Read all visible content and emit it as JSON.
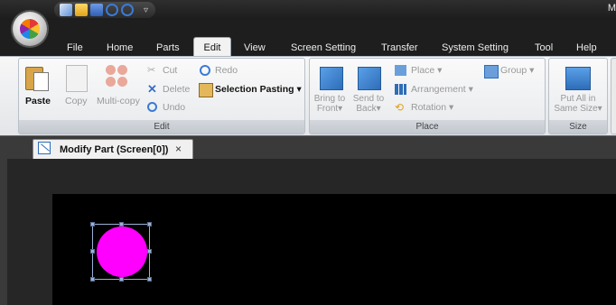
{
  "window": {
    "title_fragment": "M"
  },
  "quick_access": {
    "icons": [
      "new-icon",
      "open-icon",
      "save-icon",
      "undo-icon",
      "redo-icon"
    ],
    "dropdown": "▿"
  },
  "tabs": [
    "File",
    "Home",
    "Parts",
    "Edit",
    "View",
    "Screen Setting",
    "Transfer",
    "System Setting",
    "Tool",
    "Help"
  ],
  "ribbon": {
    "edit_group": {
      "label": "Edit",
      "paste": "Paste",
      "copy": "Copy",
      "multicopy": "Multi-copy",
      "cut": "Cut",
      "delete": "Delete",
      "undo": "Undo",
      "redo": "Redo",
      "selection_pasting": "Selection Pasting",
      "selection_pasting_arrow": "▾"
    },
    "place_group": {
      "label": "Place",
      "bring_to_front": [
        "Bring to",
        "Front▾"
      ],
      "send_to_back": [
        "Send to",
        "Back▾"
      ],
      "place": "Place ▾",
      "arrangement": "Arrangement ▾",
      "rotation": "Rotation ▾",
      "group": "Group ▾"
    },
    "size_group": {
      "label": "Size",
      "put_all": [
        "Put All in",
        "Same Size▾"
      ]
    }
  },
  "document": {
    "tab_label": "Modify Part (Screen[0])",
    "close": "×"
  },
  "colors": {
    "part_fill": "#ff00ff",
    "screen_bg": "#000000"
  }
}
